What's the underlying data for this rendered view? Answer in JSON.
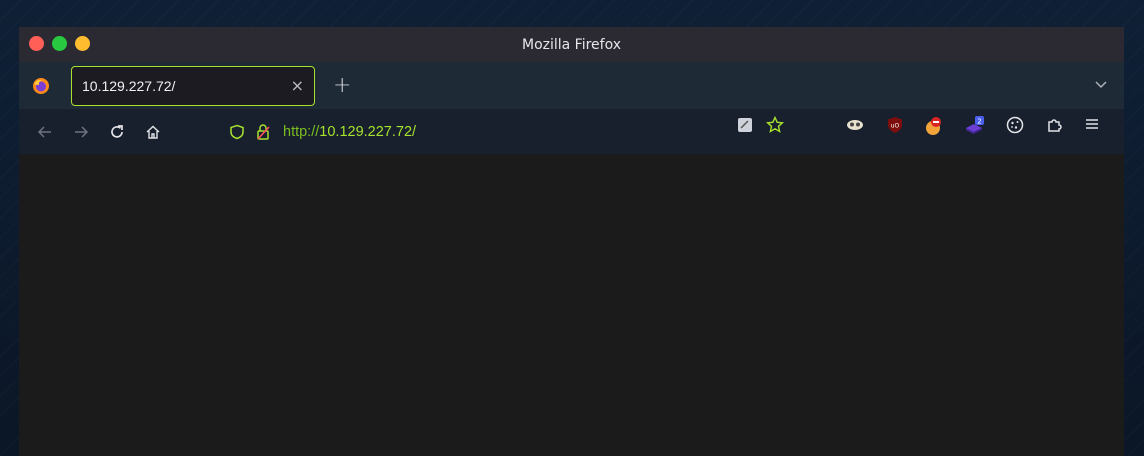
{
  "window": {
    "title": "Mozilla Firefox"
  },
  "tab": {
    "title": "10.129.227.72/",
    "close_glyph": "×",
    "new_tab_glyph": "+"
  },
  "navbar": {
    "url_scheme": "http://",
    "url_host": "10.129.227.72/"
  },
  "toolbar": {
    "extension_badge": "2"
  },
  "colors": {
    "accent": "#a6e22e",
    "url_scheme": "#7bbf22",
    "tab_border": "#a6e22e"
  },
  "icons": [
    "firefox-logo-icon",
    "close-icon",
    "plus-icon",
    "chevron-down-icon",
    "back-arrow-icon",
    "forward-arrow-icon",
    "reload-icon",
    "home-icon",
    "shield-icon",
    "lock-icon",
    "reader-mode-icon",
    "bookmark-star-icon",
    "extension-mask-icon",
    "ublock-icon",
    "no-script-icon",
    "extension-badge-icon",
    "cookie-icon",
    "extensions-icon",
    "hamburger-menu-icon"
  ]
}
